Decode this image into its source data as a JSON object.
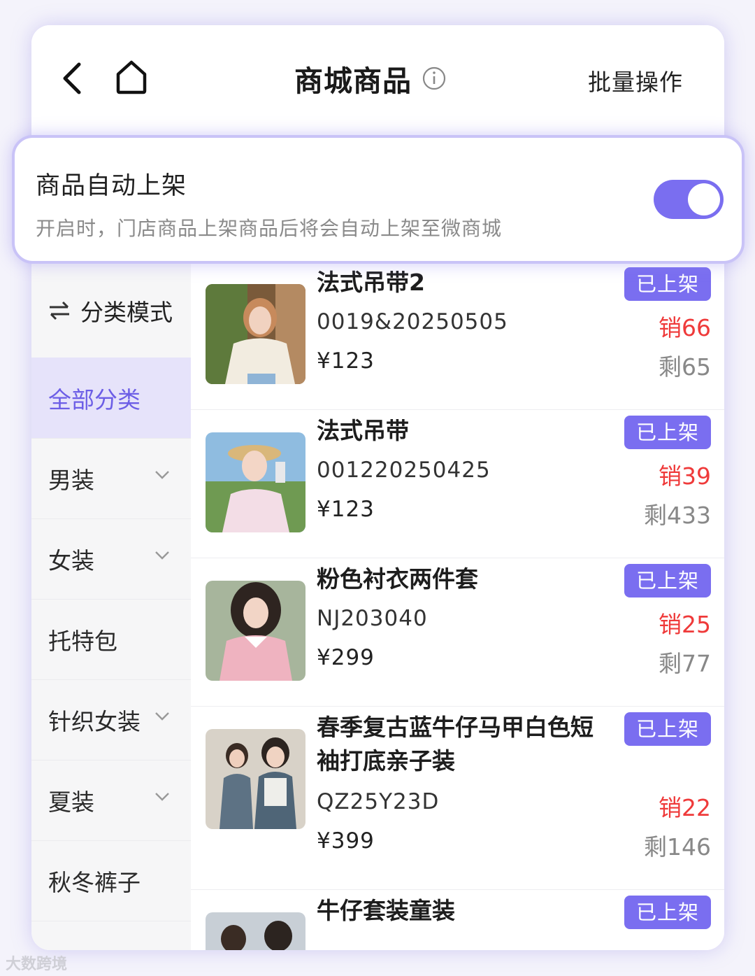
{
  "header": {
    "title": "商城商品",
    "batch_label": "批量操作"
  },
  "auto_listing": {
    "title": "商品自动上架",
    "description": "开启时，门店商品上架商品后将会自动上架至微商城",
    "enabled": true
  },
  "sidebar": {
    "mode_label": "分类模式",
    "categories": [
      {
        "label": "全部分类",
        "active": true,
        "expandable": false
      },
      {
        "label": "男装",
        "active": false,
        "expandable": true
      },
      {
        "label": "女装",
        "active": false,
        "expandable": true
      },
      {
        "label": "托特包",
        "active": false,
        "expandable": false
      },
      {
        "label": "针织女装",
        "active": false,
        "expandable": true
      },
      {
        "label": "夏装",
        "active": false,
        "expandable": true
      },
      {
        "label": "秋冬裤子",
        "active": false,
        "expandable": false
      }
    ]
  },
  "products": [
    {
      "name": "法式吊带2",
      "code": "0019&20250505",
      "price": "¥123",
      "status": "已上架",
      "sold": "销66",
      "stock": "剩65"
    },
    {
      "name": "法式吊带",
      "code": "001220250425",
      "price": "¥123",
      "status": "已上架",
      "sold": "销39",
      "stock": "剩433"
    },
    {
      "name": "粉色衬衣两件套",
      "code": "NJ203040",
      "price": "¥299",
      "status": "已上架",
      "sold": "销25",
      "stock": "剩77"
    },
    {
      "name": "春季复古蓝牛仔马甲白色短袖打底亲子装",
      "code": "QZ25Y23D",
      "price": "¥399",
      "status": "已上架",
      "sold": "销22",
      "stock": "剩146"
    },
    {
      "name": "牛仔套装童装",
      "code": "",
      "price": "",
      "status": "已上架",
      "sold": "",
      "stock": ""
    }
  ],
  "watermark": "大数跨境",
  "colors": {
    "accent": "#7a6ef0",
    "sold": "#ef3a3a",
    "active_bg": "#e6e3fa"
  }
}
